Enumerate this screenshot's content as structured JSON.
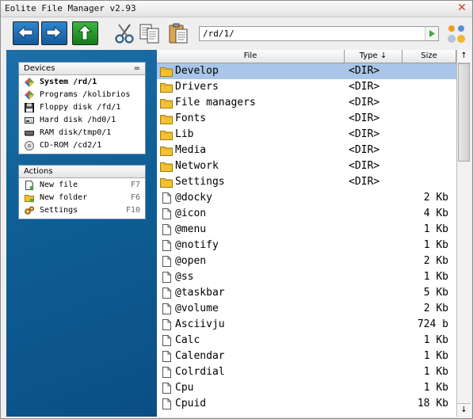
{
  "window": {
    "title": "Eolite File Manager v2.93"
  },
  "toolbar": {
    "path": "/rd/1/"
  },
  "devices": {
    "header": "Devices",
    "toggle": "=",
    "items": [
      {
        "label": "System /rd/1",
        "icon": "system-icon",
        "bold": true
      },
      {
        "label": "Programs /kolibrios",
        "icon": "programs-icon"
      },
      {
        "label": "Floppy disk /fd/1",
        "icon": "floppy-icon"
      },
      {
        "label": "Hard disk /hd0/1",
        "icon": "hard-disk-icon"
      },
      {
        "label": "RAM disk/tmp0/1",
        "icon": "ram-disk-icon"
      },
      {
        "label": "CD-ROM /cd2/1",
        "icon": "cdrom-icon"
      }
    ]
  },
  "actions": {
    "header": "Actions",
    "items": [
      {
        "label": "New file",
        "key": "F7",
        "icon": "new-file-icon"
      },
      {
        "label": "New folder",
        "key": "F6",
        "icon": "new-folder-icon"
      },
      {
        "label": "Settings",
        "key": "F10",
        "icon": "settings-icon"
      }
    ]
  },
  "columns": {
    "file": "File",
    "type": "Type ↓",
    "size": "Size",
    "scroll_up": "↑",
    "scroll_down": "↓"
  },
  "files": [
    {
      "name": "Develop",
      "type": "<DIR>",
      "size": "",
      "kind": "folder",
      "selected": true
    },
    {
      "name": "Drivers",
      "type": "<DIR>",
      "size": "",
      "kind": "folder"
    },
    {
      "name": "File managers",
      "type": "<DIR>",
      "size": "",
      "kind": "folder"
    },
    {
      "name": "Fonts",
      "type": "<DIR>",
      "size": "",
      "kind": "folder"
    },
    {
      "name": "Lib",
      "type": "<DIR>",
      "size": "",
      "kind": "folder"
    },
    {
      "name": "Media",
      "type": "<DIR>",
      "size": "",
      "kind": "folder"
    },
    {
      "name": "Network",
      "type": "<DIR>",
      "size": "",
      "kind": "folder"
    },
    {
      "name": "Settings",
      "type": "<DIR>",
      "size": "",
      "kind": "folder"
    },
    {
      "name": "@docky",
      "type": "",
      "size": "2 Kb",
      "kind": "file"
    },
    {
      "name": "@icon",
      "type": "",
      "size": "4 Kb",
      "kind": "file"
    },
    {
      "name": "@menu",
      "type": "",
      "size": "1 Kb",
      "kind": "file"
    },
    {
      "name": "@notify",
      "type": "",
      "size": "1 Kb",
      "kind": "file"
    },
    {
      "name": "@open",
      "type": "",
      "size": "2 Kb",
      "kind": "file"
    },
    {
      "name": "@ss",
      "type": "",
      "size": "1 Kb",
      "kind": "file"
    },
    {
      "name": "@taskbar",
      "type": "",
      "size": "5 Kb",
      "kind": "file"
    },
    {
      "name": "@volume",
      "type": "",
      "size": "2 Kb",
      "kind": "file"
    },
    {
      "name": "Asciivju",
      "type": "",
      "size": "724 b",
      "kind": "file"
    },
    {
      "name": "Calc",
      "type": "",
      "size": "1 Kb",
      "kind": "file"
    },
    {
      "name": "Calendar",
      "type": "",
      "size": "1 Kb",
      "kind": "file"
    },
    {
      "name": "Colrdial",
      "type": "",
      "size": "1 Kb",
      "kind": "file"
    },
    {
      "name": "Cpu",
      "type": "",
      "size": "1 Kb",
      "kind": "file"
    },
    {
      "name": "Cpuid",
      "type": "",
      "size": "18 Kb",
      "kind": "file"
    }
  ],
  "colors": {
    "selection": "#a9c6e8",
    "sidebar": "#0f5f96",
    "folder": "#f2c230"
  }
}
